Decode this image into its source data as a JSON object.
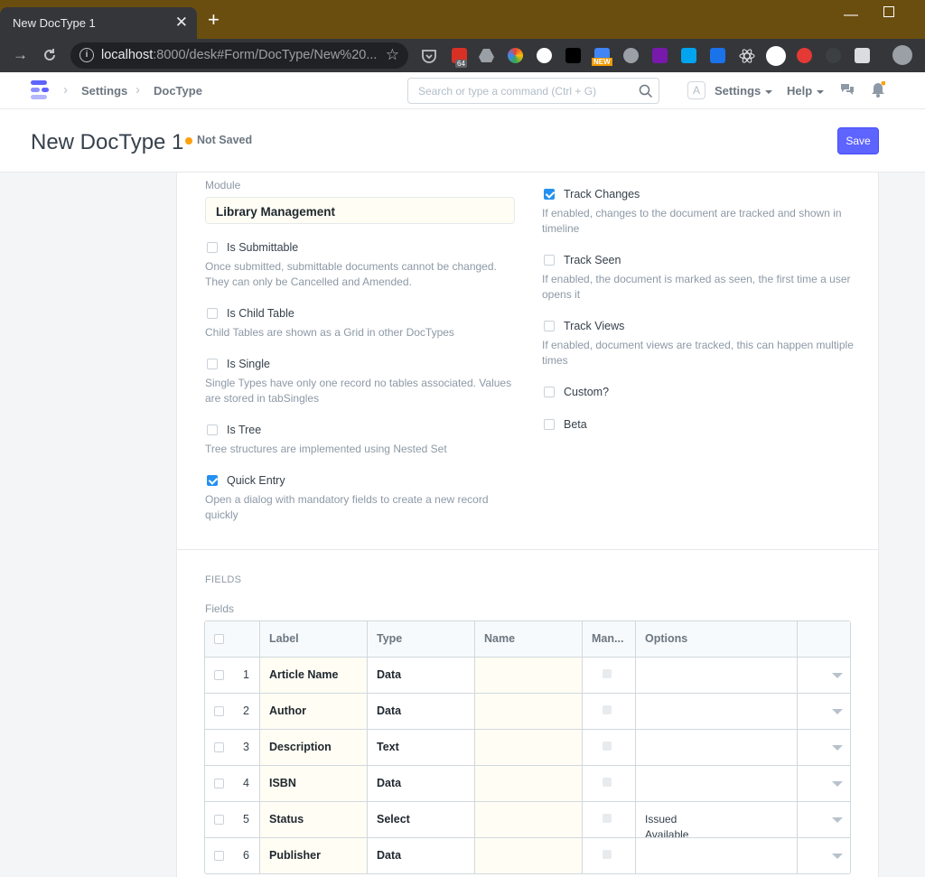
{
  "browser": {
    "tab_title": "New DocType 1",
    "tab_close": "✕",
    "new_tab": "+",
    "url_host": "localhost",
    "url_rest": ":8000/desk#Form/DocType/New%20...",
    "ext_badge_count": "64",
    "ext_badge_new": "NEW"
  },
  "navbar": {
    "breadcrumbs": [
      "Settings",
      "DocType"
    ],
    "search_placeholder": "Search or type a command (Ctrl + G)",
    "avatar_letter": "A",
    "settings_menu": "Settings",
    "help_menu": "Help"
  },
  "page": {
    "title": "New DocType 1",
    "status": "Not Saved",
    "save_label": "Save"
  },
  "form": {
    "module_label": "Module",
    "module_value": "Library Management",
    "left_checks": [
      {
        "label": "Is Submittable",
        "checked": false,
        "desc": [
          "Once submitted, submittable documents cannot be changed.",
          "They can only be Cancelled and Amended."
        ]
      },
      {
        "label": "Is Child Table",
        "checked": false,
        "desc": [
          "Child Tables are shown as a Grid in other DocTypes"
        ]
      },
      {
        "label": "Is Single",
        "checked": false,
        "desc": [
          "Single Types have only one record no tables associated. Values",
          "are stored in tabSingles"
        ]
      },
      {
        "label": "Is Tree",
        "checked": false,
        "desc": [
          "Tree structures are implemented using Nested Set"
        ]
      },
      {
        "label": "Quick Entry",
        "checked": true,
        "desc": [
          "Open a dialog with mandatory fields to create a new record",
          "quickly"
        ]
      }
    ],
    "right_checks": [
      {
        "label": "Track Changes",
        "checked": true,
        "desc": [
          "If enabled, changes to the document are tracked and shown in",
          "timeline"
        ]
      },
      {
        "label": "Track Seen",
        "checked": false,
        "desc": [
          "If enabled, the document is marked as seen, the first time a user",
          "opens it"
        ]
      },
      {
        "label": "Track Views",
        "checked": false,
        "desc": [
          "If enabled, document views are tracked, this can happen multiple",
          "times"
        ]
      },
      {
        "label": "Custom?",
        "checked": false,
        "desc": []
      },
      {
        "label": "Beta",
        "checked": false,
        "desc": []
      }
    ],
    "section_title": "FIELDS",
    "fields_label": "Fields"
  },
  "grid": {
    "columns": [
      "Label",
      "Type",
      "Name",
      "Man...",
      "Options"
    ],
    "rows": [
      {
        "idx": "1",
        "label": "Article Name",
        "type": "Data",
        "name": "",
        "options": []
      },
      {
        "idx": "2",
        "label": "Author",
        "type": "Data",
        "name": "",
        "options": []
      },
      {
        "idx": "3",
        "label": "Description",
        "type": "Text",
        "name": "",
        "options": []
      },
      {
        "idx": "4",
        "label": "ISBN",
        "type": "Data",
        "name": "",
        "options": []
      },
      {
        "idx": "5",
        "label": "Status",
        "type": "Select",
        "name": "",
        "options": [
          "Issued",
          "Available"
        ]
      },
      {
        "idx": "6",
        "label": "Publisher",
        "type": "Data",
        "name": "",
        "options": []
      }
    ]
  },
  "colors": {
    "accent": "#5e64ff",
    "checkbox_checked": "#2490ef",
    "status_dot": "#ffa00a",
    "titlebar": "#6a4e10"
  }
}
